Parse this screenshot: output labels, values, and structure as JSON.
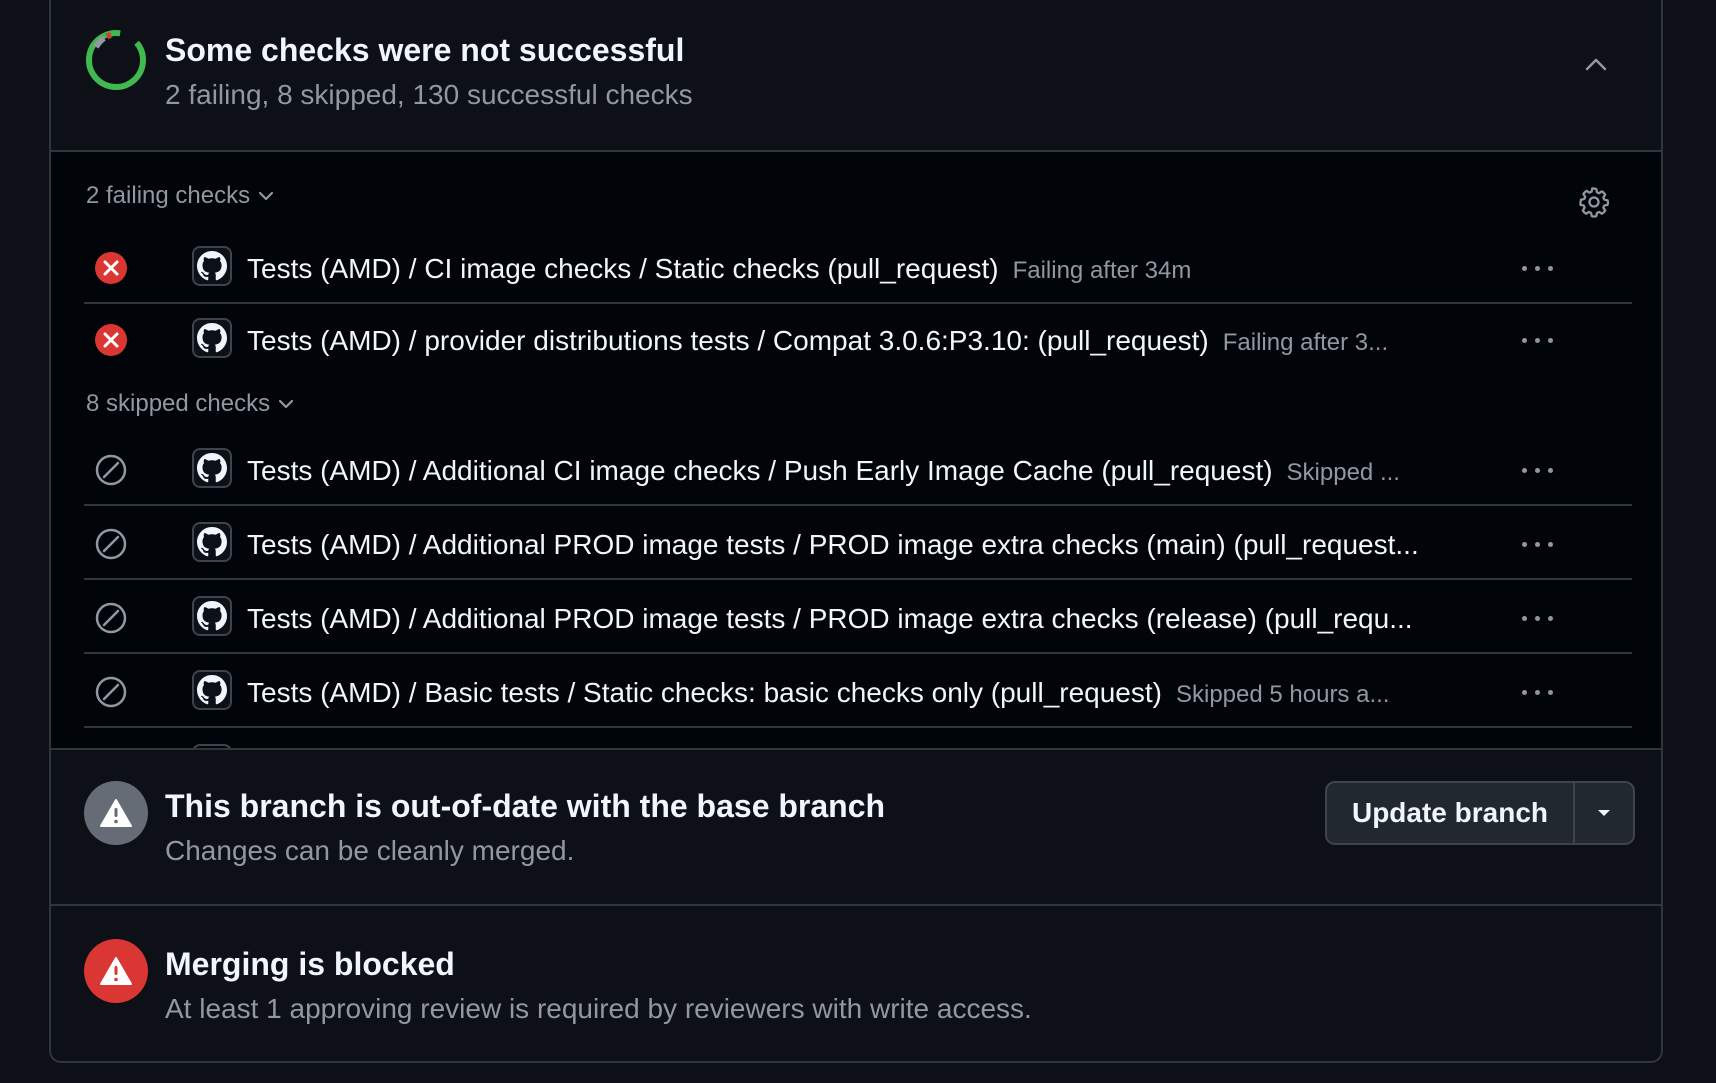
{
  "colors": {
    "success": "#3fb950",
    "failure": "#da3633",
    "neutral": "#656c76",
    "muted_text": "#9198a1"
  },
  "checks_summary": {
    "status_icon": "partial-progress-ring-icon",
    "title": "Some checks were not successful",
    "subtitle": "2 failing, 8 skipped, 130 successful checks",
    "collapse_icon": "chevron-up-icon"
  },
  "failing_group": {
    "label": "2 failing checks",
    "toggle_icon": "chevron-down-icon",
    "settings_icon": "gear-icon",
    "items": [
      {
        "status": "failure",
        "name": "Tests (AMD) / CI image checks / Static checks (pull_request)",
        "meta": "Failing after 34m"
      },
      {
        "status": "failure",
        "name": "Tests (AMD) / provider distributions tests / Compat 3.0.6:P3.10: (pull_request)",
        "meta": "Failing after 3..."
      }
    ]
  },
  "skipped_group": {
    "label": "8 skipped checks",
    "toggle_icon": "chevron-down-icon",
    "items": [
      {
        "status": "skipped",
        "name": "Tests (AMD) / Additional CI image checks / Push Early Image Cache (pull_request)",
        "meta": "Skipped ..."
      },
      {
        "status": "skipped",
        "name": "Tests (AMD) / Additional PROD image tests / PROD image extra checks (main) (pull_request...",
        "meta": ""
      },
      {
        "status": "skipped",
        "name": "Tests (AMD) / Additional PROD image tests / PROD image extra checks (release) (pull_requ...",
        "meta": ""
      },
      {
        "status": "skipped",
        "name": "Tests (AMD) / Basic tests / Static checks: basic checks only (pull_request)",
        "meta": "Skipped 5 hours a..."
      }
    ]
  },
  "branch_status": {
    "icon": "alert-icon",
    "title": "This branch is out-of-date with the base branch",
    "subtitle": "Changes can be cleanly merged.",
    "update_button_label": "Update branch",
    "update_menu_icon": "triangle-down-icon"
  },
  "merge_status": {
    "icon": "alert-icon",
    "title": "Merging is blocked",
    "subtitle": "At least 1 approving review is required by reviewers with write access."
  }
}
